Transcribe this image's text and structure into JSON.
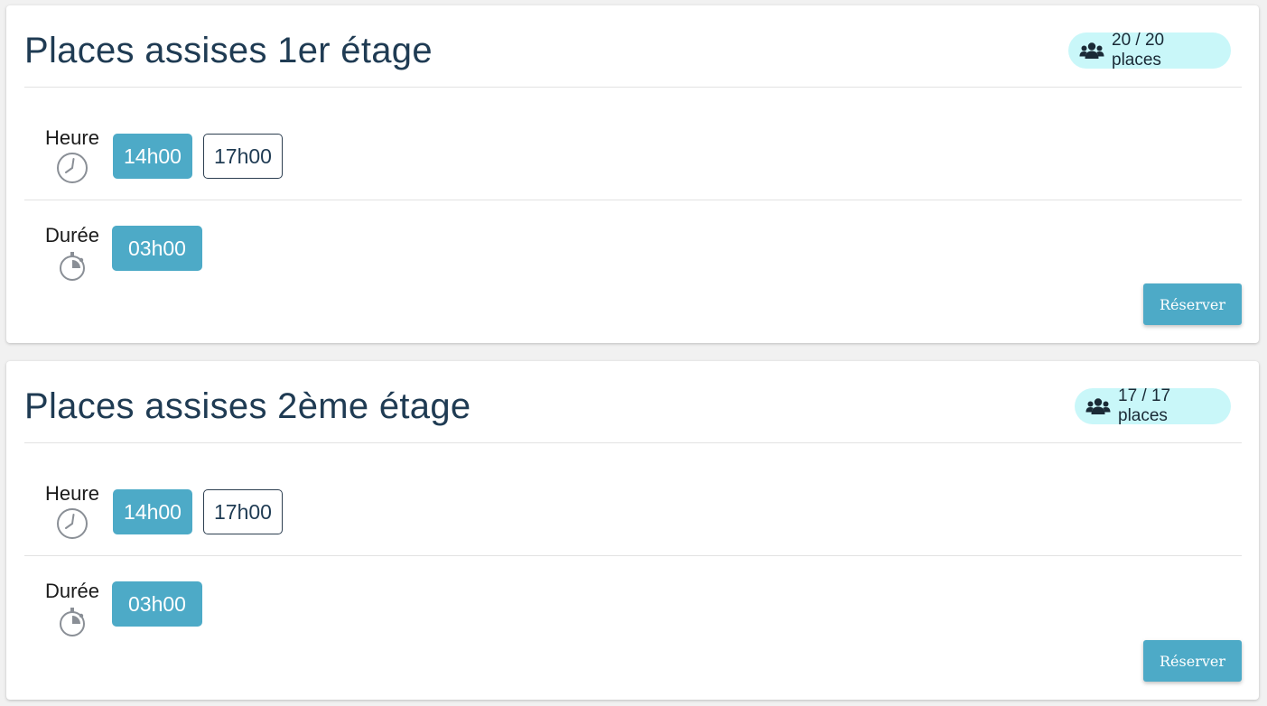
{
  "colors": {
    "accent": "#4daac7",
    "badge_bg": "#c9f7f9",
    "title": "#1f3b53",
    "page_bg": "#f1f1f1"
  },
  "cards": [
    {
      "title": "Places assises 1er étage",
      "capacity": "20 / 20 places",
      "capacity_icon": "users-icon",
      "heure_label": "Heure",
      "heure_icon": "clock-icon",
      "times": [
        {
          "label": "14h00",
          "selected": true
        },
        {
          "label": "17h00",
          "selected": false
        }
      ],
      "duree_label": "Durée",
      "duree_icon": "stopwatch-icon",
      "durations": [
        {
          "label": "03h00",
          "selected": true
        }
      ],
      "reserve_label": "Réserver"
    },
    {
      "title": "Places assises 2ème étage",
      "capacity": "17 / 17 places",
      "capacity_icon": "users-icon",
      "heure_label": "Heure",
      "heure_icon": "clock-icon",
      "times": [
        {
          "label": "14h00",
          "selected": true
        },
        {
          "label": "17h00",
          "selected": false
        }
      ],
      "duree_label": "Durée",
      "duree_icon": "stopwatch-icon",
      "durations": [
        {
          "label": "03h00",
          "selected": true
        }
      ],
      "reserve_label": "Réserver"
    }
  ]
}
